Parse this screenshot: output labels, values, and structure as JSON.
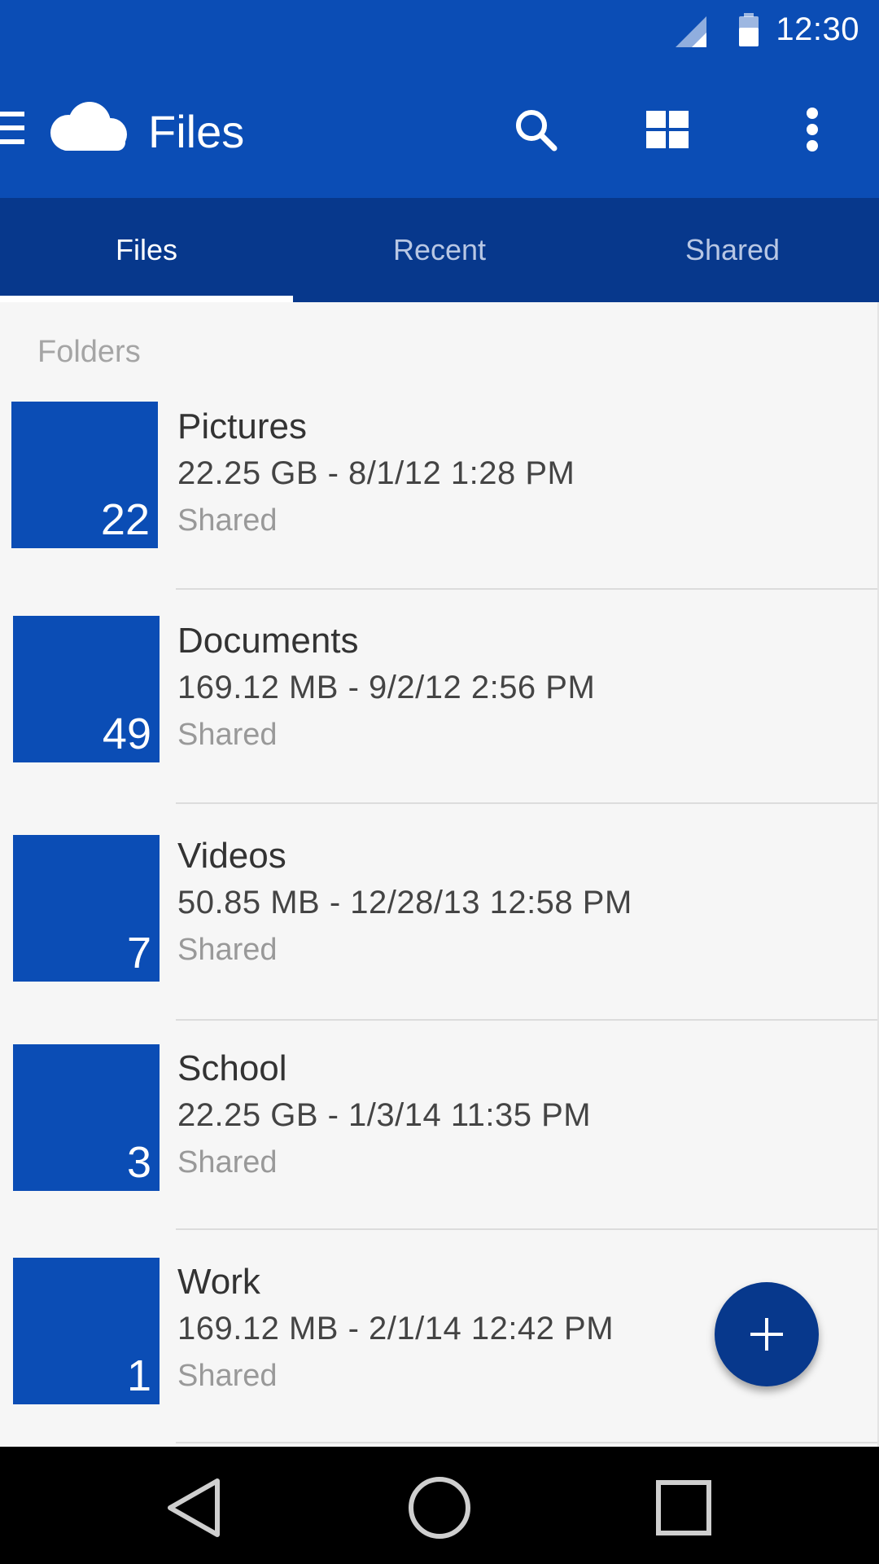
{
  "status_bar": {
    "time": "12:30",
    "signal_icon": "cell-signal-icon",
    "battery_icon": "battery-icon"
  },
  "app_bar": {
    "title": "Files",
    "menu_icon": "hamburger-menu-icon",
    "logo_icon": "cloud-icon",
    "actions": [
      "search-icon",
      "grid-view-icon",
      "more-vertical-icon"
    ]
  },
  "tabs": [
    {
      "label": "Files",
      "active": true
    },
    {
      "label": "Recent",
      "active": false
    },
    {
      "label": "Shared",
      "active": false
    }
  ],
  "section_header": "Folders",
  "folders": [
    {
      "name": "Pictures",
      "count": "22",
      "meta": "22.25 GB - 8/1/12 1:28 PM",
      "status": "Shared"
    },
    {
      "name": "Documents",
      "count": "49",
      "meta": "169.12 MB - 9/2/12 2:56 PM",
      "status": "Shared"
    },
    {
      "name": "Videos",
      "count": "7",
      "meta": "50.85 MB - 12/28/13 12:58 PM",
      "status": "Shared"
    },
    {
      "name": "School",
      "count": "3",
      "meta": "22.25 GB - 1/3/14 11:35 PM",
      "status": "Shared"
    },
    {
      "name": "Work",
      "count": "1",
      "meta": "169.12 MB - 2/1/14 12:42 PM",
      "status": "Shared"
    }
  ],
  "fab_icon": "plus-icon",
  "nav_bar": [
    "back-icon",
    "home-icon",
    "recents-icon"
  ],
  "colors": {
    "primary": "#0b4db5",
    "primary_dark": "#07388c",
    "background": "#f6f6f6"
  }
}
